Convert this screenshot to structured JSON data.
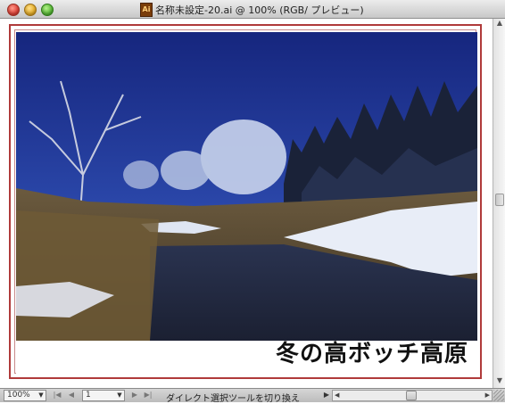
{
  "window": {
    "title": "名称未設定-20.ai @ 100% (RGB/ プレビュー)",
    "doc_icon_label": "Ai"
  },
  "artwork": {
    "caption": "冬の高ボッチ高原",
    "artboard_border_color": "#b03a3a",
    "sky_color": "#1c2f8c"
  },
  "statusbar": {
    "zoom_value": "100%",
    "page_value": "1",
    "status_text": "ダイレクト選択ツールを切り換え",
    "first_page_icon": "first-page-icon",
    "prev_page_icon": "prev-page-icon",
    "next_page_icon": "next-page-icon",
    "last_page_icon": "last-page-icon"
  }
}
